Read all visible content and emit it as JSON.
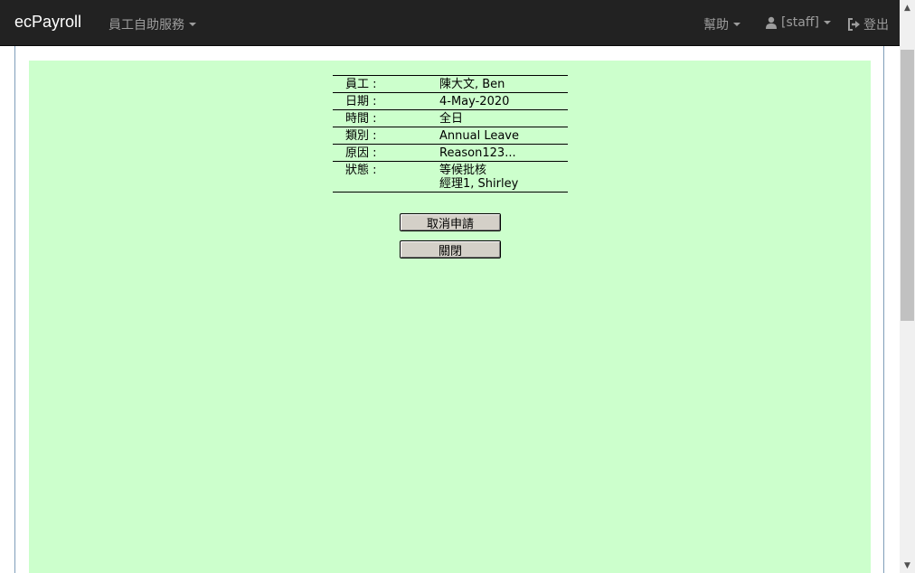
{
  "navbar": {
    "brand": "ecPayroll",
    "menu": "員工自助服務",
    "help": "幫助",
    "user": "[staff]",
    "logout": "登出"
  },
  "details": {
    "rows": [
      {
        "label": "員工 :",
        "value": "陳大文, Ben"
      },
      {
        "label": "日期 :",
        "value": "4-May-2020"
      },
      {
        "label": "時間 :",
        "value": "全日"
      },
      {
        "label": "類別 :",
        "value": "Annual Leave"
      },
      {
        "label": "原因 :",
        "value": "Reason123..."
      },
      {
        "label": "狀態 :",
        "value": "等候批核",
        "value2": "經理1, Shirley"
      }
    ]
  },
  "buttons": {
    "cancel_request": "取消申請",
    "close": "關閉"
  },
  "colors": {
    "navbar_bg": "#222222",
    "content_bg": "#ccffcc"
  }
}
